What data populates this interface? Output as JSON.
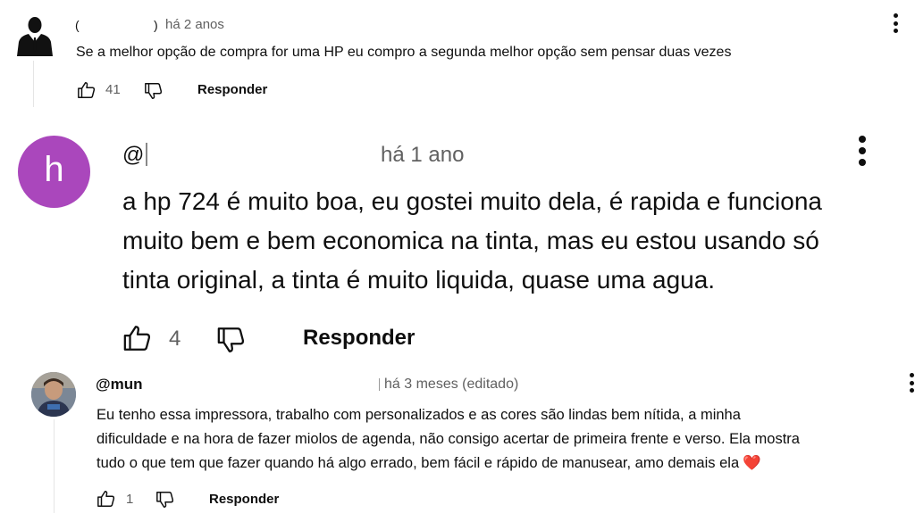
{
  "comments": [
    {
      "author": "(",
      "author_tail": ")",
      "time": "há 2 anos",
      "text": "Se a melhor opção de compra for uma HP eu compro a segunda melhor opção sem pensar duas vezes",
      "likes": "41",
      "reply_label": "Responder",
      "avatar_icon": "businessman-silhouette-icon"
    },
    {
      "author": "@",
      "time": "há 1 ano",
      "text_lines": [
        "a hp 724 é muito boa, eu gostei muito dela, é rapida e funciona",
        "muito bem e bem economica na tinta, mas eu estou usando só",
        "tinta original, a tinta é muito liquida, quase uma agua."
      ],
      "likes": "4",
      "reply_label": "Responder",
      "avatar_letter": "h",
      "avatar_color": "#aa47bc"
    },
    {
      "author": "@mun",
      "time": "há 3 meses (editado)",
      "text_lines": [
        "Eu tenho essa impressora, trabalho com personalizados e as cores são lindas bem nítida, a minha",
        "dificuldade e na hora de fazer miolos de agenda, não consigo acertar de primeira frente e verso. Ela mostra",
        "tudo o que tem que fazer quando há algo errado, bem fácil e rápido de manusear, amo demais ela"
      ],
      "heart_emoji": "❤️",
      "likes": "1",
      "reply_label": "Responder",
      "avatar_icon": "child-photo-avatar"
    }
  ]
}
